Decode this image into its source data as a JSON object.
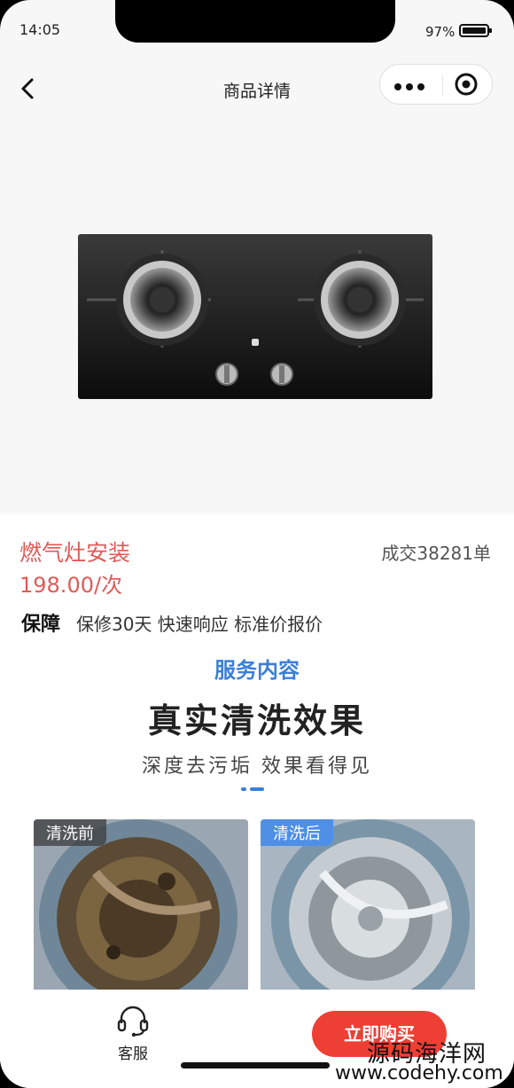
{
  "status_bar": {
    "time": "14:05",
    "battery_percent": "97%"
  },
  "nav": {
    "title": "商品详情",
    "back_icon": "chevron-left-icon",
    "more_icon": "more-dots-icon",
    "close_icon": "target-icon"
  },
  "product": {
    "image_icon": "gas-stove-image",
    "name": "燃气灶安装",
    "price": "198.00/次",
    "sold": "成交38281单",
    "guarantee_label": "保障",
    "guarantee_text": "保修30天 快速响应 标准价报价"
  },
  "service": {
    "section_title": "服务内容",
    "headline": "真实清洗效果",
    "subline": "深度去污垢 效果看得见",
    "before_tag": "清洗前",
    "after_tag": "清洗后"
  },
  "bottom_bar": {
    "service_label": "客服",
    "service_icon": "headset-icon",
    "buy_label": "立即购买"
  },
  "watermark": {
    "line1": "源码海洋网",
    "line2": "www.codehy.com"
  },
  "colors": {
    "accent_red": "#e05a57",
    "buy_button": "#ee3f34",
    "accent_blue": "#3b7fd8"
  }
}
